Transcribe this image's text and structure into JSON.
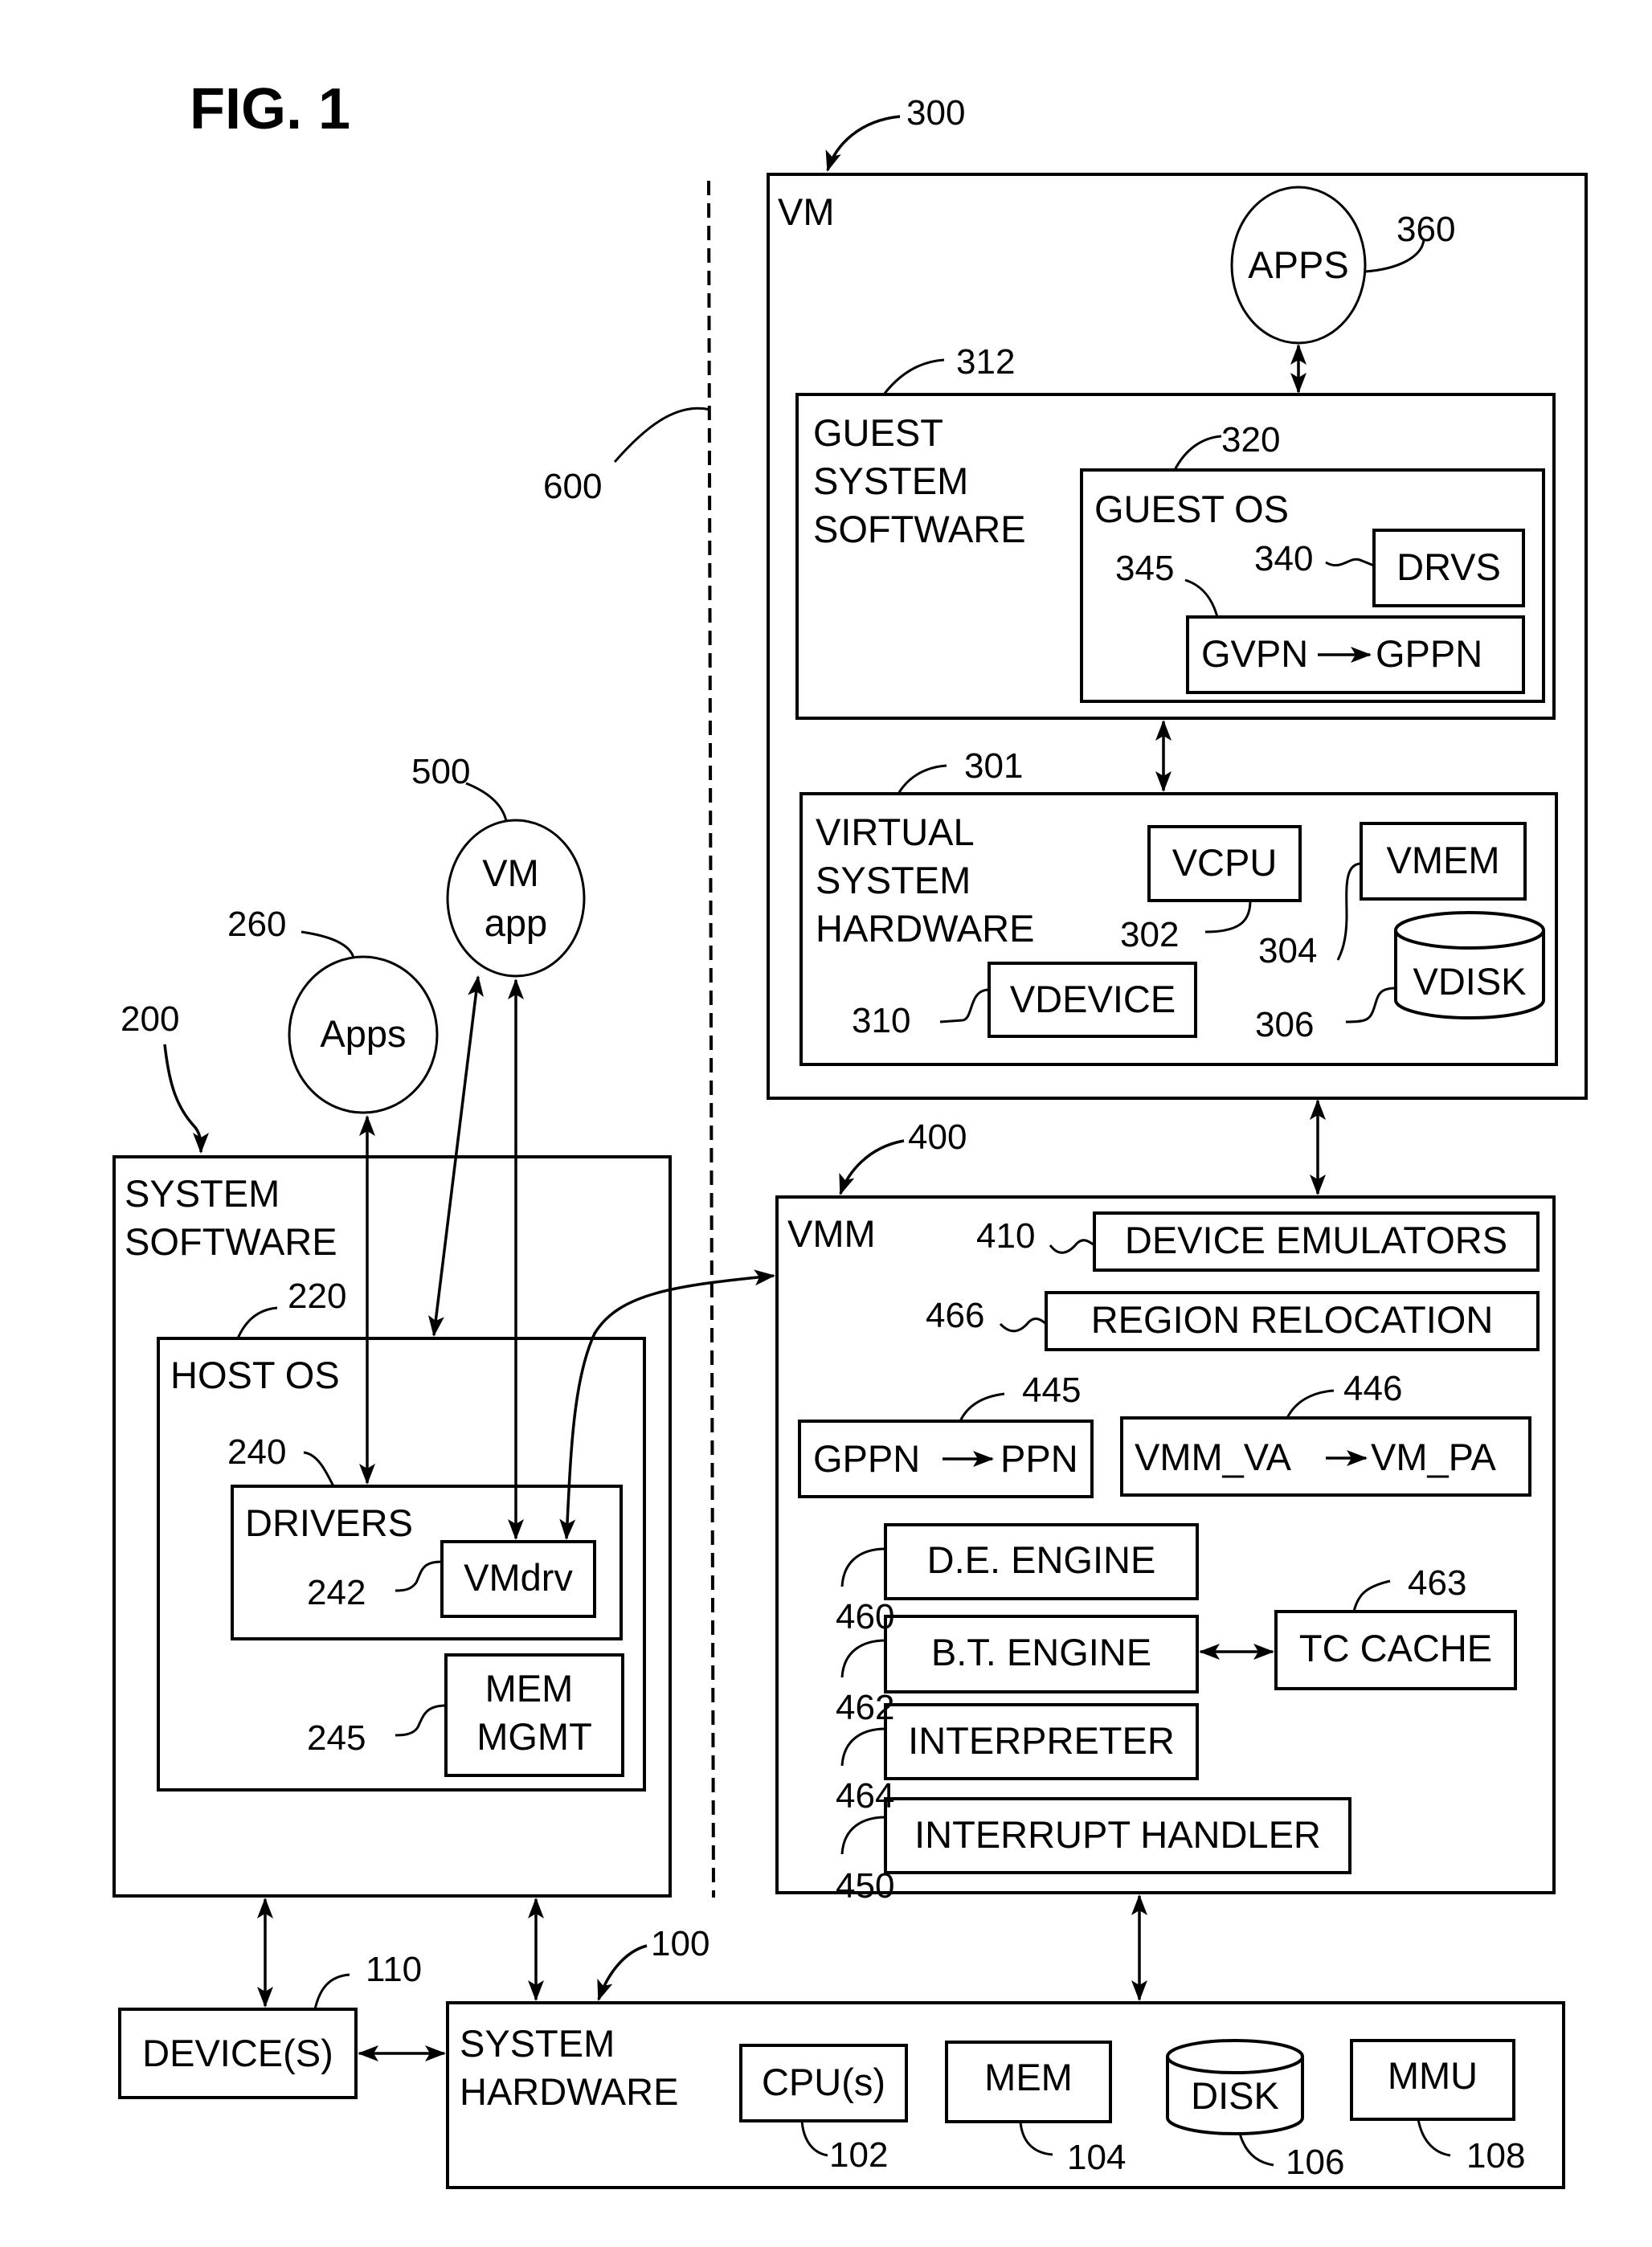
{
  "figure_title": "FIG. 1",
  "separator": {
    "ref": "600"
  },
  "vm": {
    "ref": "300",
    "label": "VM",
    "apps": {
      "label": "APPS",
      "ref": "360"
    },
    "guest_system_software": {
      "ref": "312",
      "label_lines": [
        "GUEST",
        "SYSTEM",
        "SOFTWARE"
      ],
      "guest_os": {
        "ref": "320",
        "label": "GUEST OS",
        "drvs": {
          "label": "DRVS",
          "ref": "340"
        },
        "gvpn_map": {
          "from": "GVPN",
          "to": "GPPN",
          "ref": "345"
        }
      }
    },
    "virtual_system_hardware": {
      "ref": "301",
      "label_lines": [
        "VIRTUAL",
        "SYSTEM",
        "HARDWARE"
      ],
      "vcpu": {
        "label": "VCPU",
        "ref": "302"
      },
      "vmem": {
        "label": "VMEM",
        "ref": "304"
      },
      "vdisk": {
        "label": "VDISK",
        "ref": "306"
      },
      "vdevice": {
        "label": "VDEVICE",
        "ref": "310"
      }
    }
  },
  "vmm": {
    "ref": "400",
    "label": "VMM",
    "device_emulators": {
      "label": "DEVICE EMULATORS",
      "ref": "410"
    },
    "region_relocation": {
      "label": "REGION RELOCATION",
      "ref": "466"
    },
    "gppn_map": {
      "from": "GPPN",
      "to": "PPN",
      "ref": "445"
    },
    "vmm_va_map": {
      "from": "VMM_VA",
      "to": "VM_PA",
      "ref": "446"
    },
    "de_engine": {
      "label": "D.E. ENGINE",
      "ref": "460"
    },
    "bt_engine": {
      "label": "B.T. ENGINE",
      "ref": "462"
    },
    "tc_cache": {
      "label": "TC CACHE",
      "ref": "463"
    },
    "interpreter": {
      "label": "INTERPRETER",
      "ref": "464"
    },
    "interrupt_handler": {
      "label": "INTERRUPT HANDLER",
      "ref": "450"
    }
  },
  "host": {
    "vm_app": {
      "label_lines": [
        "VM",
        "app"
      ],
      "ref": "500"
    },
    "apps": {
      "label": "Apps",
      "ref": "260"
    },
    "system_software": {
      "ref": "200",
      "label_lines": [
        "SYSTEM",
        "SOFTWARE"
      ],
      "host_os": {
        "ref": "220",
        "label": "HOST OS",
        "drivers": {
          "label": "DRIVERS",
          "ref": "240",
          "vmdrv": {
            "label": "VMdrv",
            "ref": "242"
          }
        },
        "mem_mgmt": {
          "label_lines": [
            "MEM",
            "MGMT"
          ],
          "ref": "245"
        }
      }
    }
  },
  "devices": {
    "label": "DEVICE(S)",
    "ref": "110"
  },
  "system_hardware": {
    "ref": "100",
    "label_lines": [
      "SYSTEM",
      "HARDWARE"
    ],
    "cpu": {
      "label": "CPU(s)",
      "ref": "102"
    },
    "mem": {
      "label": "MEM",
      "ref": "104"
    },
    "disk": {
      "label": "DISK",
      "ref": "106"
    },
    "mmu": {
      "label": "MMU",
      "ref": "108"
    }
  }
}
